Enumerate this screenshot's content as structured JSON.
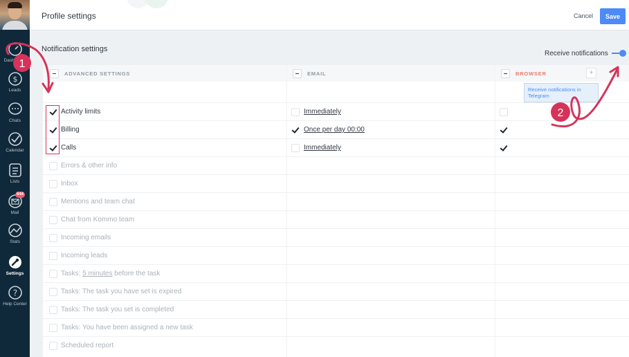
{
  "header": {
    "title": "Profile settings",
    "cancel_label": "Cancel",
    "save_label": "Save"
  },
  "sidebar": {
    "items": [
      {
        "label": "Dashboard",
        "icon": "dashboard-icon"
      },
      {
        "label": "Leads",
        "icon": "dollar-icon"
      },
      {
        "label": "Chats",
        "icon": "chat-icon"
      },
      {
        "label": "Calendar",
        "icon": "check-circle-icon"
      },
      {
        "label": "Lists",
        "icon": "list-icon"
      },
      {
        "label": "Mail",
        "icon": "mail-icon",
        "badge": "644"
      },
      {
        "label": "Stats",
        "icon": "stats-icon"
      },
      {
        "label": "Settings",
        "icon": "wrench-icon",
        "active": true
      },
      {
        "label": "Help Center",
        "icon": "question-icon"
      }
    ]
  },
  "notifications": {
    "section_title": "Notification settings",
    "receive_label": "Receive notifications",
    "receive_enabled": true,
    "tooltip": "Receive notifications in Telegram",
    "columns": {
      "advanced": "ADVANCED SETTINGS",
      "email": "EMAIL",
      "browser": "BROWSER",
      "add": "+"
    },
    "rows": [
      {
        "name": "Activity limits",
        "enabled": true,
        "email_checked": false,
        "email_freq": "Immediately",
        "browser_checked": false
      },
      {
        "name": "Billing",
        "enabled": true,
        "email_checked": true,
        "email_freq": "Once per day 00:00",
        "browser_checked": true
      },
      {
        "name": "Calls",
        "enabled": true,
        "email_checked": false,
        "email_freq": "Immediately",
        "browser_checked": true
      },
      {
        "name": "Errors & other info",
        "enabled": false
      },
      {
        "name": "Inbox",
        "enabled": false
      },
      {
        "name": "Mentions and team chat",
        "enabled": false
      },
      {
        "name": "Chat from Kommo team",
        "enabled": false
      },
      {
        "name": "Incoming emails",
        "enabled": false
      },
      {
        "name": "Incoming leads",
        "enabled": false
      },
      {
        "name_prefix": "Tasks: ",
        "name_link": "5 minutes",
        "name_suffix": " before the task",
        "enabled": false
      },
      {
        "name": "Tasks: The task you have set is expired",
        "enabled": false
      },
      {
        "name": "Tasks: The task you set is completed",
        "enabled": false
      },
      {
        "name": "Tasks: You have been assigned a new task",
        "enabled": false
      },
      {
        "name": "Scheduled report",
        "enabled": false
      }
    ]
  },
  "annotations": {
    "marker_1": "1",
    "marker_2": "2",
    "color": "#d6335a"
  }
}
